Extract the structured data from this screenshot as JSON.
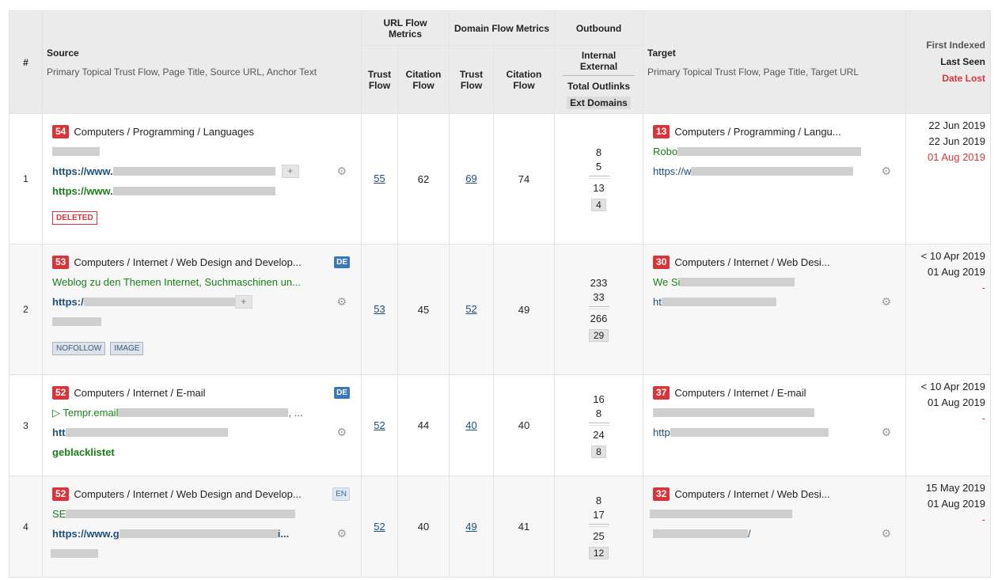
{
  "header": {
    "hash": "#",
    "source_title": "Source",
    "source_sub": "Primary Topical Trust Flow, Page Title, Source URL, Anchor Text",
    "url_flow": "URL Flow Metrics",
    "domain_flow": "Domain Flow Metrics",
    "outbound": "Outbound",
    "trust_flow": "Trust Flow",
    "citation_flow": "Citation Flow",
    "internal": "Internal",
    "external": "External",
    "total_outlinks": "Total Outlinks",
    "ext_domains": "Ext Domains",
    "target_title": "Target",
    "target_sub": "Primary Topical Trust Flow, Page Title, Target URL",
    "first_indexed": "First Indexed",
    "last_seen": "Last Seen",
    "date_lost": "Date Lost"
  },
  "rows": [
    {
      "n": "1",
      "src_tf": "54",
      "src_cat": "Computers / Programming / Languages",
      "src_line2": "",
      "src_url": "https://www.",
      "src_anchor": "https://www.",
      "tag1": "DELETED",
      "url_tf": "55",
      "url_cf": "62",
      "dom_tf": "69",
      "dom_cf": "74",
      "internal": "8",
      "external": "5",
      "total": "13",
      "ext_domains": "4",
      "tgt_tf": "13",
      "tgt_cat": "Computers / Programming / Langu...",
      "tgt_title": "Robo",
      "tgt_url": "https://w",
      "first": "22 Jun 2019",
      "last": "22 Jun 2019",
      "lost": "01 Aug 2019"
    },
    {
      "n": "2",
      "src_tf": "53",
      "src_cat": "Computers / Internet / Web Design and Develop...",
      "lang": "DE",
      "src_title": "Weblog zu den Themen Internet, Suchmaschinen un...",
      "src_url": "https:/",
      "tag1": "NOFOLLOW",
      "tag2": "IMAGE",
      "url_tf": "53",
      "url_cf": "45",
      "dom_tf": "52",
      "dom_cf": "49",
      "internal": "233",
      "external": "33",
      "total": "266",
      "ext_domains": "29",
      "tgt_tf": "30",
      "tgt_cat": "Computers / Internet / Web Desi...",
      "tgt_title": "We Si",
      "tgt_url": "ht",
      "first": "< 10 Apr 2019",
      "last": "01 Aug 2019",
      "lost": "-"
    },
    {
      "n": "3",
      "src_tf": "52",
      "src_cat": "Computers / Internet / E-mail",
      "lang": "DE",
      "src_title": "▷ Tempr.email",
      "src_title_tail": ", ...",
      "src_url": "htt",
      "src_anchor": "geblacklistet",
      "url_tf": "52",
      "url_cf": "44",
      "dom_tf": "40",
      "dom_cf": "40",
      "internal": "16",
      "external": "8",
      "total": "24",
      "ext_domains": "8",
      "tgt_tf": "37",
      "tgt_cat": "Computers / Internet / E-mail",
      "tgt_url": "http",
      "first": "< 10 Apr 2019",
      "last": "01 Aug 2019",
      "lost": "-"
    },
    {
      "n": "4",
      "src_tf": "52",
      "src_cat": "Computers / Internet / Web Design and Develop...",
      "lang": "EN",
      "src_title": "SE",
      "src_url": "https://www.g",
      "src_url_tail": "i...",
      "url_tf": "52",
      "url_cf": "40",
      "dom_tf": "49",
      "dom_cf": "41",
      "internal": "8",
      "external": "17",
      "total": "25",
      "ext_domains": "12",
      "tgt_tf": "32",
      "tgt_cat": "Computers / Internet / Web Desi...",
      "tgt_url_tail": "/",
      "first": "15 May 2019",
      "last": "01 Aug 2019",
      "lost": "-"
    }
  ],
  "icons": {
    "gear": "gear-icon",
    "plus": "plus-icon"
  },
  "colors": {
    "trust_badge": "#d9343a",
    "anchor_green": "#1a7f1a",
    "link_blue": "#1d4f7a",
    "lost_red": "#d9343a"
  }
}
